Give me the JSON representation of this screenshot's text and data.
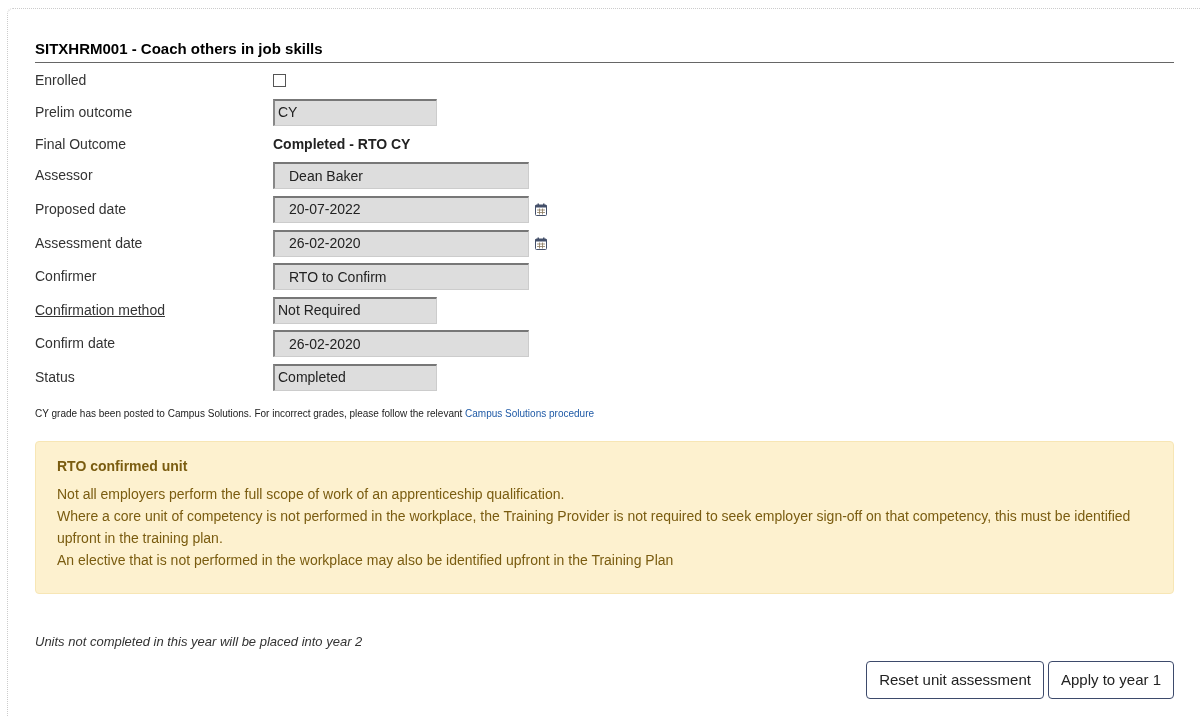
{
  "title": "SITXHRM001 - Coach others in job skills",
  "fields": [
    {
      "label": "Enrolled",
      "kind": "checkbox",
      "checked": false,
      "label_link": false
    },
    {
      "label": "Prelim outcome",
      "kind": "short_field",
      "value": "CY",
      "label_link": false
    },
    {
      "label": "Final Outcome",
      "kind": "text",
      "value": "Completed - RTO CY",
      "label_link": false
    },
    {
      "label": "Assessor",
      "kind": "wide_field",
      "value": "Dean Baker",
      "label_link": false
    },
    {
      "label": "Proposed date",
      "kind": "date_field",
      "value": "20-07-2022",
      "label_link": false
    },
    {
      "label": "Assessment date",
      "kind": "date_field",
      "value": "26-02-2020",
      "label_link": false
    },
    {
      "label": "Confirmer",
      "kind": "wide_field",
      "value": "RTO to Confirm",
      "label_link": false
    },
    {
      "label": "Confirmation method",
      "kind": "short_field",
      "value": "Not Required",
      "label_link": true
    },
    {
      "label": "Confirm date",
      "kind": "wide_field",
      "value": "26-02-2020",
      "label_link": false
    },
    {
      "label": "Status",
      "kind": "short_field",
      "value": "Completed",
      "label_link": false
    }
  ],
  "note": {
    "text": "CY grade has been posted to Campus Solutions. For incorrect grades, please follow the relevant",
    "link": "Campus Solutions procedure"
  },
  "alert": {
    "title": "RTO confirmed unit",
    "lines": [
      "Not all employers perform the full scope of work of an apprenticeship qualification.",
      "Where a core unit of competency is not performed in the workplace, the Training Provider is not required to seek employer sign-off on that competency, this must be identified upfront in the training plan.",
      "An elective that is not performed in the workplace may also be identified upfront in the Training Plan"
    ]
  },
  "footer_note": "Units not completed in this year will be placed into year 2",
  "buttons": [
    "Reset unit assessment",
    "Apply to year 1"
  ]
}
